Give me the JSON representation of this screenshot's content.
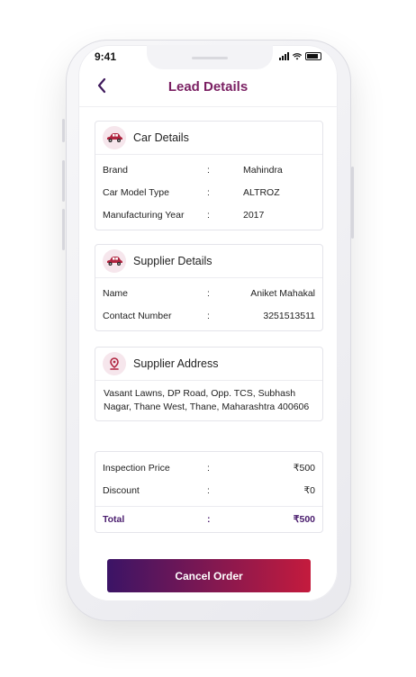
{
  "status_bar": {
    "time": "9:41"
  },
  "header": {
    "title": "Lead Details",
    "back_icon": "chevron-left-icon"
  },
  "car_details": {
    "title": "Car Details",
    "icon": "car-icon",
    "rows": [
      {
        "label": "Brand",
        "sep": ":",
        "value": "Mahindra"
      },
      {
        "label": "Car Model Type",
        "sep": ":",
        "value": "ALTROZ"
      },
      {
        "label": "Manufacturing Year",
        "sep": ":",
        "value": "2017"
      }
    ]
  },
  "supplier_details": {
    "title": "Supplier Details",
    "icon": "car-icon",
    "rows": [
      {
        "label": "Name",
        "sep": ":",
        "value": "Aniket Mahakal"
      },
      {
        "label": "Contact Number",
        "sep": ":",
        "value": "3251513511"
      }
    ]
  },
  "supplier_address": {
    "title": "Supplier Address",
    "icon": "location-pin-icon",
    "address": "Vasant Lawns, DP Road, Opp. TCS, Subhash Nagar, Thane West, Thane, Maharashtra 400606"
  },
  "pricing": {
    "rows": [
      {
        "label": "Inspection Price",
        "sep": ":",
        "value": "₹500"
      },
      {
        "label": "Discount",
        "sep": ":",
        "value": "₹0"
      }
    ],
    "total": {
      "label": "Total",
      "sep": ":",
      "value": "₹500"
    }
  },
  "actions": {
    "cancel_label": "Cancel Order"
  },
  "colors": {
    "accent": "#7a1f62",
    "gradient_start": "#3b1466",
    "gradient_end": "#c41b3d",
    "icon_red": "#b0243f"
  }
}
